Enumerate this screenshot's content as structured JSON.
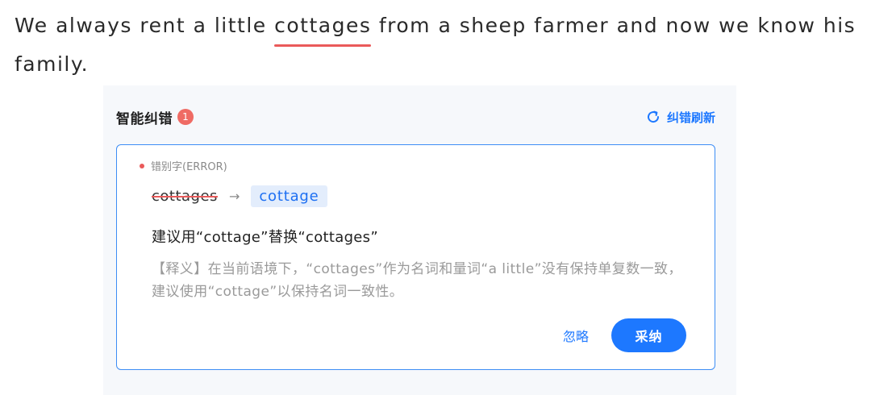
{
  "sentence": {
    "before": "We always rent a little ",
    "flagged_word": "cottages",
    "after": " from a sheep farmer and now we know his family."
  },
  "panel": {
    "title": "智能纠错",
    "badge_count": "1",
    "refresh_label": "纠错刷新"
  },
  "card": {
    "category": "错别字(ERROR)",
    "original_word": "cottages",
    "arrow": "→",
    "suggested_word": "cottage",
    "suggestion": "建议用“cottage”替换“cottages”",
    "explanation": "【释义】在当前语境下，“cottages”作为名词和量词“a little”没有保持单复数一致，建议使用“cottage”以保持名词一致性。",
    "ignore_label": "忽略",
    "adopt_label": "采纳"
  },
  "colors": {
    "accent": "#1d78ff",
    "error": "#ea5a5a"
  }
}
